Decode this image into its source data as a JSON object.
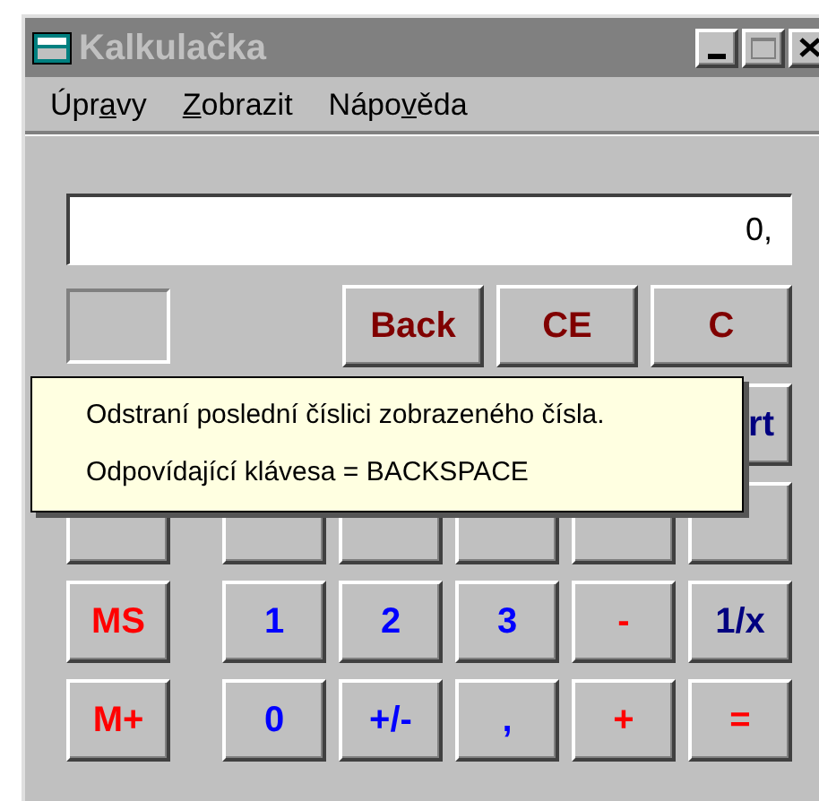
{
  "window": {
    "title": "Kalkulačka"
  },
  "menu": [
    {
      "before": "Úpr",
      "key": "a",
      "after": "vy"
    },
    {
      "key": "Z",
      "after": "obrazit"
    },
    {
      "before": "Nápo",
      "key": "v",
      "after": "ěda"
    }
  ],
  "display": {
    "value": "0,"
  },
  "edit_keys": [
    {
      "label": "Back"
    },
    {
      "label": "CE"
    },
    {
      "label": "C"
    }
  ],
  "rows": [
    {
      "keys": [
        {
          "label": "rt",
          "kind": "function",
          "cut": true
        }
      ]
    },
    {
      "memory": {
        "label": "MS"
      },
      "keys": [
        {
          "label": "1",
          "kind": "digit"
        },
        {
          "label": "2",
          "kind": "digit"
        },
        {
          "label": "3",
          "kind": "digit"
        },
        {
          "label": "-",
          "kind": "operator"
        },
        {
          "label": "1/x",
          "kind": "function"
        }
      ]
    },
    {
      "memory": {
        "label": "M+"
      },
      "keys": [
        {
          "label": "0",
          "kind": "digit"
        },
        {
          "label": "+/-",
          "kind": "digit"
        },
        {
          "label": ",",
          "kind": "digit"
        },
        {
          "label": "+",
          "kind": "operator"
        },
        {
          "label": "=",
          "kind": "operator"
        }
      ]
    }
  ],
  "tooltip": {
    "lines": [
      "Odstraní poslední číslici zobrazeného čísla.",
      "Odpovídající klávesa = BACKSPACE"
    ]
  }
}
